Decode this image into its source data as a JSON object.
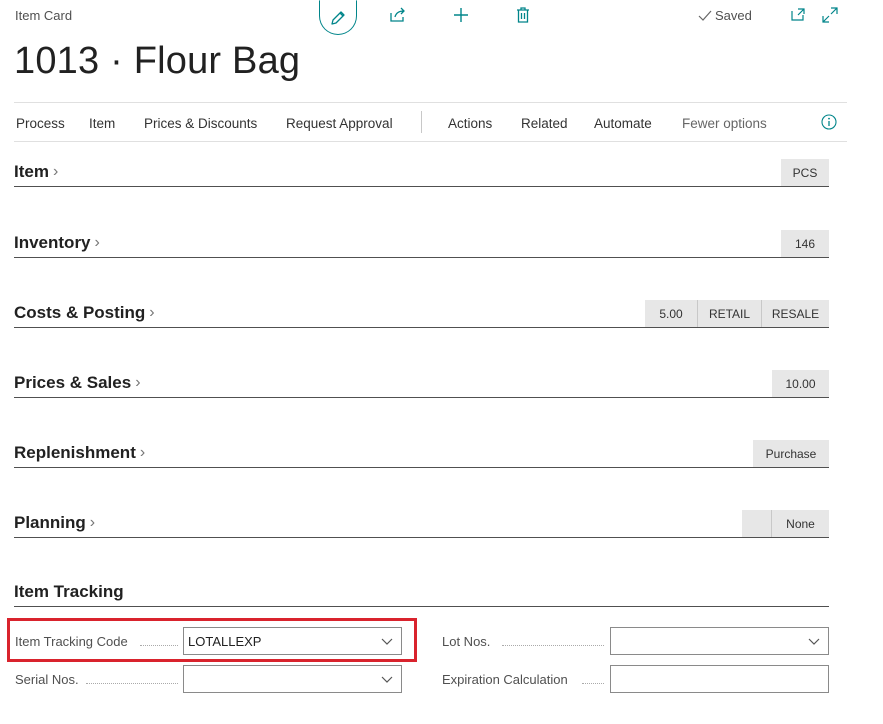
{
  "header": {
    "caption": "Item Card",
    "title": "1013 · Flour Bag",
    "status": "Saved"
  },
  "icons": {
    "edit": "pencil-icon",
    "share": "share-icon",
    "new": "plus-icon",
    "delete": "trash-icon",
    "saved": "checkmark-icon",
    "popout": "popout-icon",
    "expand": "expand-icon",
    "info": "info-icon"
  },
  "actionbar": {
    "items": [
      "Process",
      "Item",
      "Prices & Discounts",
      "Request Approval",
      "Actions",
      "Related",
      "Automate",
      "Fewer options"
    ]
  },
  "fasttabs": [
    {
      "title": "Item",
      "pills": [
        "PCS"
      ]
    },
    {
      "title": "Inventory",
      "pills": [
        "146"
      ]
    },
    {
      "title": "Costs & Posting",
      "pills": [
        "5.00",
        "RETAIL",
        "RESALE"
      ]
    },
    {
      "title": "Prices & Sales",
      "pills": [
        "10.00"
      ]
    },
    {
      "title": "Replenishment",
      "pills": [
        "Purchase"
      ]
    },
    {
      "title": "Planning",
      "pills": [
        "",
        "None"
      ]
    }
  ],
  "item_tracking": {
    "title": "Item Tracking",
    "fields": {
      "item_tracking_code": {
        "label": "Item Tracking Code",
        "value": "LOTALLEXP"
      },
      "serial_nos": {
        "label": "Serial Nos.",
        "value": ""
      },
      "lot_nos": {
        "label": "Lot Nos.",
        "value": ""
      },
      "expiration_calculation": {
        "label": "Expiration Calculation",
        "value": ""
      }
    }
  },
  "colors": {
    "accent": "#00858a",
    "highlight": "#d9232d",
    "pill_bg": "#e7e7e7"
  }
}
